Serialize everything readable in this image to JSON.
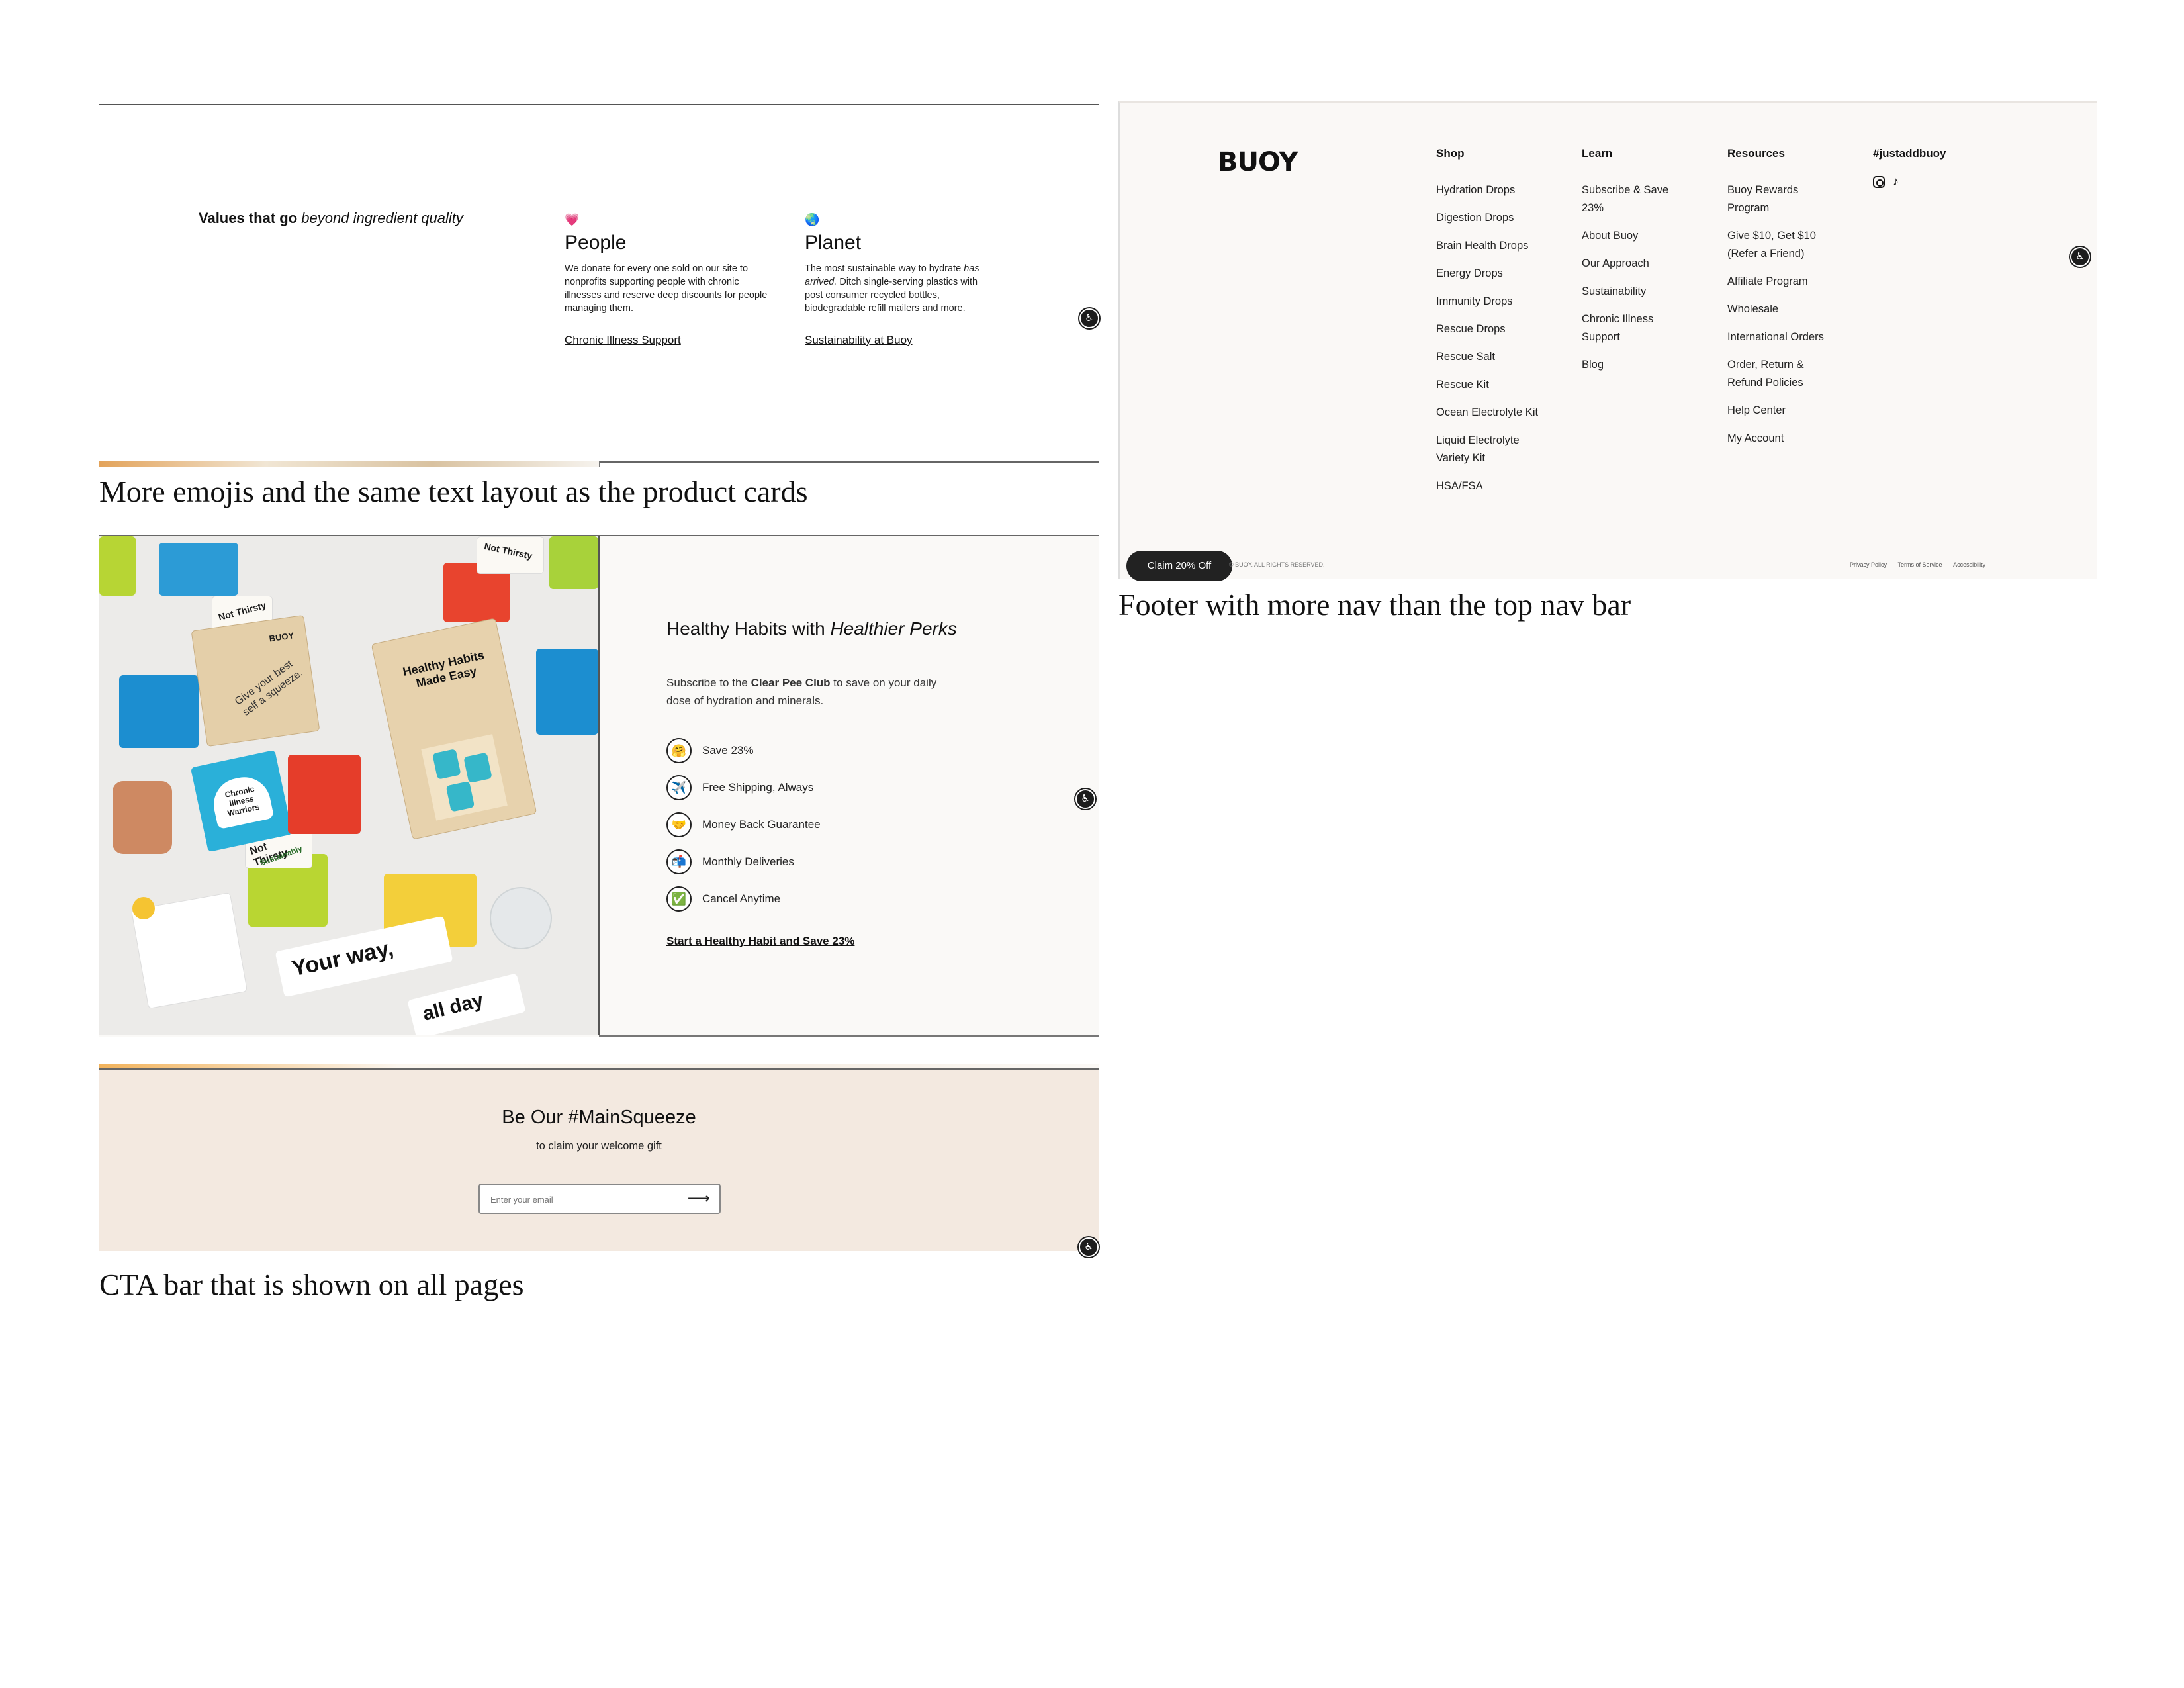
{
  "captions": {
    "values": "More emojis and the same text layout as the product cards",
    "footer": "Footer with more nav than the top nav bar",
    "cta": "CTA bar that is shown on all pages"
  },
  "values_section": {
    "heading_plain": "Values that go",
    "heading_italic": "beyond ingredient quality",
    "cards": [
      {
        "emoji": "💗",
        "icon_name": "pink-heart-icon",
        "title": "People",
        "body_1": "We donate for every one sold on our site to nonprofits supporting people with chronic illnesses and reserve deep discounts for people managing them.",
        "body_italic": "",
        "body_2": "",
        "link": "Chronic Illness Support"
      },
      {
        "emoji": "🌏",
        "icon_name": "globe-icon",
        "title": "Planet",
        "body_1": "The most sustainable way to hydrate ",
        "body_italic": "has arrived.",
        "body_2": " Ditch single-serving plastics with post consumer recycled bottles, biodegradable refill mailers and more.",
        "link": "Sustainability at Buoy"
      }
    ]
  },
  "perks_section": {
    "heading_plain": "Healthy Habits with",
    "heading_italic": "Healthier Perks",
    "subtitle_pre": "Subscribe to the ",
    "subtitle_bold": "Clear Pee Club",
    "subtitle_post": " to save on your daily dose of hydration and minerals.",
    "perks": [
      {
        "emoji": "🤗",
        "icon_name": "hugging-face-icon",
        "label": "Save 23%"
      },
      {
        "emoji": "✈️",
        "icon_name": "airplane-icon",
        "label": "Free Shipping, Always"
      },
      {
        "emoji": "🤝",
        "icon_name": "handshake-icon",
        "label": "Money Back Guarantee"
      },
      {
        "emoji": "📬",
        "icon_name": "mailbox-icon",
        "label": "Monthly Deliveries"
      },
      {
        "emoji": "✅",
        "icon_name": "check-mark-icon",
        "label": "Cancel Anytime"
      }
    ],
    "cta": "Start a Healthy Habit and Save 23%",
    "photo": {
      "box_lid_brand": "BUOY",
      "box_lid_text": "Give your best self a squeeze.",
      "open_box_text": "Healthy Habits Made Easy",
      "card_not_thirsty": "Not Thirsty",
      "card_chronic": "Chronic Illness Warriors",
      "card_sustainably": "Sustainably",
      "card_your_way": "Your way,",
      "card_all_day": "all day"
    }
  },
  "cta_bar": {
    "title": "Be Our #MainSqueeze",
    "subtitle": "to claim your welcome gift",
    "email_placeholder": "Enter your email",
    "submit_glyph": "⟶"
  },
  "footer": {
    "logo": "BUOY",
    "columns": [
      {
        "heading": "Shop",
        "links": [
          "Hydration Drops",
          "Digestion Drops",
          "Brain Health Drops",
          "Energy Drops",
          "Immunity Drops",
          "Rescue Drops",
          "Rescue Salt",
          "Rescue Kit",
          "Ocean Electrolyte Kit",
          "Liquid Electrolyte Variety Kit",
          "HSA/FSA"
        ]
      },
      {
        "heading": "Learn",
        "links": [
          "Subscribe & Save 23%",
          "About Buoy",
          "Our Approach",
          "Sustainability",
          "Chronic Illness Support",
          "Blog"
        ]
      },
      {
        "heading": "Resources",
        "links": [
          "Buoy Rewards Program",
          "Give $10, Get $10 (Refer a Friend)",
          "Affiliate Program",
          "Wholesale",
          "International Orders",
          "Order, Return & Refund Policies",
          "Help Center",
          "My Account"
        ]
      },
      {
        "heading": "#justaddbuoy",
        "links": []
      }
    ],
    "social_icons": [
      "instagram-icon",
      "tiktok-icon"
    ],
    "claim_button": "Claim 20% Off",
    "copyright": "© BUOY. ALL RIGHTS RESERVED.",
    "legal_links": [
      "Privacy Policy",
      "Terms of Service",
      "Accessibility"
    ]
  },
  "accessibility_glyph": "♿",
  "colors": {
    "cta_bg": "#f3e9e0",
    "footer_bg": "#faf8f6",
    "perks_bg": "#faf9f7",
    "claim_button_bg": "#222222"
  }
}
